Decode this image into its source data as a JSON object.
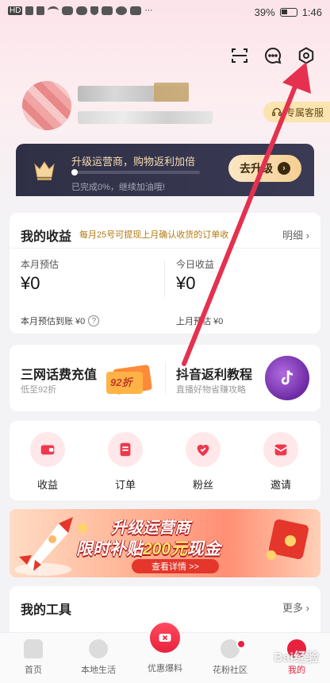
{
  "status_bar": {
    "left_indicator": "HD",
    "battery": "39%",
    "time": "1:46"
  },
  "colors": {
    "accent_red": "#e8213e",
    "gold": "#f6ddb2",
    "banner_dark": "#2f2f45",
    "annotation_arrow": "#e5304f"
  },
  "header": {
    "icons": [
      "scan-icon",
      "message-icon",
      "settings-icon"
    ],
    "service_button": "专属客服"
  },
  "upgrade": {
    "title": "升级运营商，购物返利加倍",
    "progress_text": "已完成0%，继续加油哦!",
    "progress": 0,
    "button": "去升级"
  },
  "earnings": {
    "title": "我的收益",
    "note": "每月25号可提现上月确认收货的订单收",
    "detail": "明细",
    "month_est_label": "本月预估",
    "month_est_value": "¥0",
    "today_label": "今日收益",
    "today_value": "¥0",
    "month_settle": "本月预估到账 ¥0",
    "last_month_settle": "上月预估 ¥0"
  },
  "promos": [
    {
      "title": "三网话费充值",
      "sub": "低至92折",
      "badge": "92折"
    },
    {
      "title": "抖音返利教程",
      "sub": "直播好物省赚攻略"
    }
  ],
  "grid": [
    {
      "label": "收益",
      "icon": "wallet-icon"
    },
    {
      "label": "订单",
      "icon": "order-icon"
    },
    {
      "label": "粉丝",
      "icon": "heart-icon"
    },
    {
      "label": "邀请",
      "icon": "invite-icon"
    }
  ],
  "banner": {
    "line1": "升级运营商",
    "line2_prefix": "限时补贴",
    "line2_highlight": "200元",
    "line2_suffix": "现金",
    "button": "查看详情 >>"
  },
  "tools": {
    "title": "我的工具",
    "more": "更多"
  },
  "nav": [
    {
      "label": "首页"
    },
    {
      "label": "本地生活"
    },
    {
      "label": "优惠爆料"
    },
    {
      "label": "花粉社区"
    },
    {
      "label": "我的"
    }
  ],
  "watermark": "Bai经验"
}
